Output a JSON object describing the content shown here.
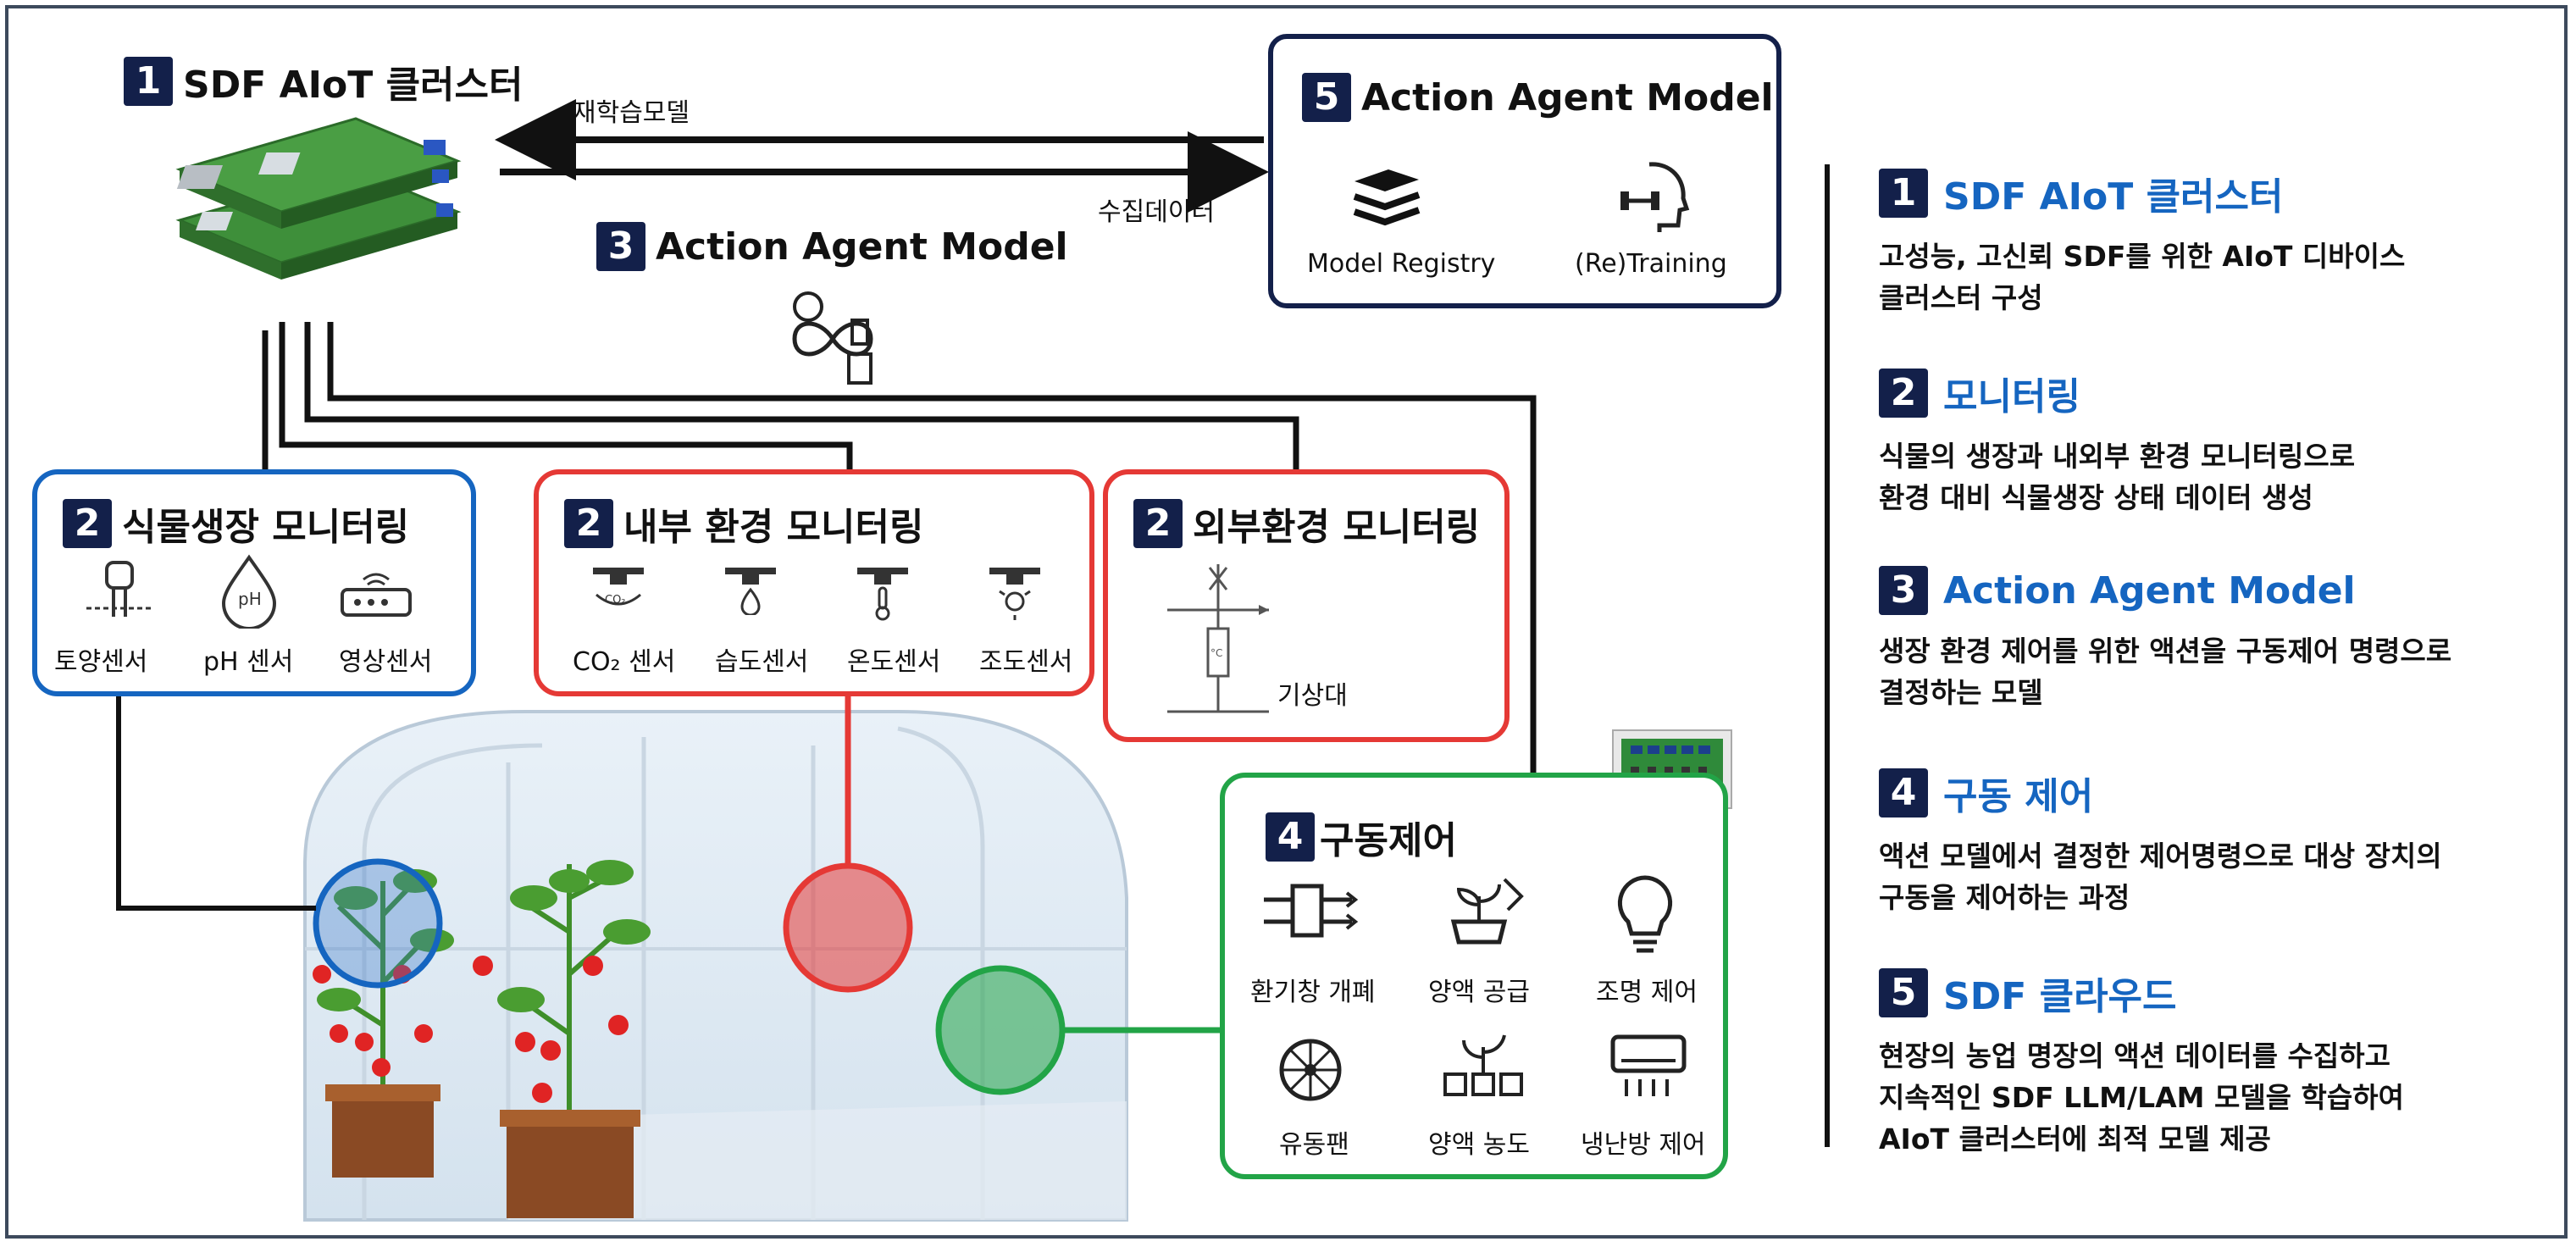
{
  "cluster": {
    "num": "1",
    "title": "SDF AIoT 클러스터"
  },
  "arrows": {
    "retrain_label": "재학습모델",
    "collect_label": "수집데이터"
  },
  "center_agent": {
    "num": "3",
    "title": "Action Agent Model"
  },
  "cloud_box": {
    "num": "5",
    "title": "Action Agent Model",
    "items": [
      {
        "label": "Model Registry",
        "icon": "books-icon"
      },
      {
        "label": "(Re)Training",
        "icon": "brain-training-icon"
      }
    ]
  },
  "plant_monitor": {
    "num": "2",
    "title": "식물생장 모니터링",
    "items": [
      {
        "label": "토양센서",
        "icon": "soil-sensor-icon"
      },
      {
        "label": "pH 센서",
        "icon": "ph-drop-icon"
      },
      {
        "label": "영상센서",
        "icon": "camera-router-icon"
      }
    ]
  },
  "internal_monitor": {
    "num": "2",
    "title": "내부 환경 모니터링",
    "items": [
      {
        "label": "CO₂ 센서",
        "icon": "co2-sensor-icon"
      },
      {
        "label": "습도센서",
        "icon": "humidity-sensor-icon"
      },
      {
        "label": "온도센서",
        "icon": "temperature-sensor-icon"
      },
      {
        "label": "조도센서",
        "icon": "light-sensor-icon"
      }
    ]
  },
  "external_monitor": {
    "num": "2",
    "title": "외부환경 모니터링",
    "items": [
      {
        "label": "기상대",
        "icon": "weather-station-icon"
      }
    ]
  },
  "drive_control": {
    "num": "4",
    "title": "구동제어",
    "items": [
      {
        "label": "환기창 개폐",
        "icon": "vent-window-icon"
      },
      {
        "label": "양액 공급",
        "icon": "nutrient-supply-icon"
      },
      {
        "label": "조명 제어",
        "icon": "lightbulb-icon"
      },
      {
        "label": "유동팬",
        "icon": "fan-icon"
      },
      {
        "label": "양액 농도",
        "icon": "nutrient-concentration-icon"
      },
      {
        "label": "냉난방 제어",
        "icon": "air-conditioner-icon"
      }
    ]
  },
  "right_panel": {
    "items": [
      {
        "num": "1",
        "title": "SDF AIoT 클러스터",
        "lines": [
          "고성능, 고신뢰  SDF를 위한 AIoT 디바이스",
          "클러스터 구성"
        ]
      },
      {
        "num": "2",
        "title": "모니터링",
        "lines": [
          "식물의 생장과 내외부 환경 모니터링으로",
          "환경 대비 식물생장 상태 데이터 생성"
        ]
      },
      {
        "num": "3",
        "title": "Action Agent Model",
        "lines": [
          "생장 환경 제어를 위한 액션을 구동제어 명령으로",
          "결정하는 모델"
        ]
      },
      {
        "num": "4",
        "title": "구동 제어",
        "lines": [
          "액션 모델에서 결정한 제어명령으로 대상 장치의",
          "구동을 제어하는 과정"
        ]
      },
      {
        "num": "5",
        "title": "SDF 클라우드",
        "lines": [
          "현장의 농업 명장의 액션 데이터를 수집하고",
          "지속적인 SDF LLM/LAM 모델을 학습하여",
          "AIoT 클러스터에 최적 모델 제공"
        ]
      }
    ]
  },
  "colors": {
    "blue": "#1565c0",
    "red": "#e53935",
    "green": "#22a447",
    "navy": "#13204a",
    "link_blue": "#1565c0"
  }
}
